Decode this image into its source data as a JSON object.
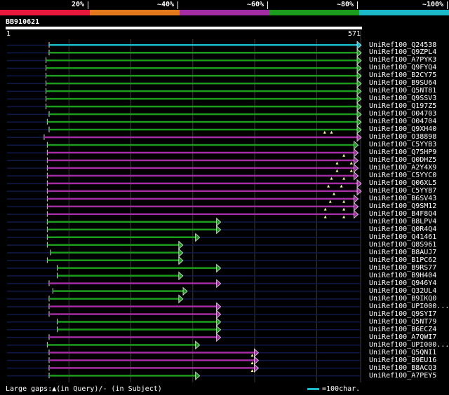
{
  "query": {
    "name": "BB910621",
    "start": "1",
    "end": "571",
    "length": 571
  },
  "legend": [
    {
      "label": "20%",
      "color": "#e8183c"
    },
    {
      "label": "~40%",
      "color": "#e4781c"
    },
    {
      "label": "~60%",
      "color": "#a42ca4"
    },
    {
      "label": "~80%",
      "color": "#1c9c1c"
    },
    {
      "label": "~100%",
      "color": "#1ab8c9"
    }
  ],
  "footer": {
    "gaps_text": "Large gaps:▲(in Query)/- (in Subject)",
    "scale_text": "=100char."
  },
  "hits": [
    {
      "name": "UniRef100_Q24538",
      "qstart": 68,
      "qend": 571,
      "identity": "~100%",
      "color": "#1ab8c9",
      "gaps": []
    },
    {
      "name": "UniRef100_Q9ZPL4",
      "qstart": 68,
      "qend": 571,
      "identity": "~80%",
      "color": "#1c9c1c",
      "gaps": []
    },
    {
      "name": "UniRef100_A7PYK3",
      "qstart": 63,
      "qend": 571,
      "identity": "~80%",
      "color": "#1c9c1c",
      "gaps": []
    },
    {
      "name": "UniRef100_Q9FYQ4",
      "qstart": 63,
      "qend": 571,
      "identity": "~80%",
      "color": "#1c9c1c",
      "gaps": []
    },
    {
      "name": "UniRef100_B2CY75",
      "qstart": 63,
      "qend": 571,
      "identity": "~80%",
      "color": "#1c9c1c",
      "gaps": []
    },
    {
      "name": "UniRef100_B9SU64",
      "qstart": 63,
      "qend": 571,
      "identity": "~80%",
      "color": "#1c9c1c",
      "gaps": []
    },
    {
      "name": "UniRef100_Q5NT81",
      "qstart": 63,
      "qend": 571,
      "identity": "~80%",
      "color": "#1c9c1c",
      "gaps": []
    },
    {
      "name": "UniRef100_Q9SSV3",
      "qstart": 63,
      "qend": 571,
      "identity": "~80%",
      "color": "#1c9c1c",
      "gaps": []
    },
    {
      "name": "UniRef100_Q197Z5",
      "qstart": 63,
      "qend": 571,
      "identity": "~80%",
      "color": "#1c9c1c",
      "gaps": []
    },
    {
      "name": "UniRef100_O04703",
      "qstart": 68,
      "qend": 571,
      "identity": "~80%",
      "color": "#1c9c1c",
      "gaps": []
    },
    {
      "name": "UniRef100_O04704",
      "qstart": 65,
      "qend": 571,
      "identity": "~80%",
      "color": "#1c9c1c",
      "gaps": []
    },
    {
      "name": "UniRef100_Q9XH40",
      "qstart": 68,
      "qend": 571,
      "identity": "~80%",
      "color": "#1c9c1c",
      "gaps": [
        513,
        524
      ]
    },
    {
      "name": "UniRef100_O38898",
      "qstart": 60,
      "qend": 571,
      "identity": "~60%",
      "color": "#a42ca4",
      "gaps": []
    },
    {
      "name": "UniRef100_C5YYB3",
      "qstart": 65,
      "qend": 566,
      "identity": "~80%",
      "color": "#1c9c1c",
      "gaps": []
    },
    {
      "name": "UniRef100_Q75HP9",
      "qstart": 65,
      "qend": 566,
      "identity": "~60%",
      "color": "#a42ca4",
      "gaps": [
        544
      ]
    },
    {
      "name": "UniRef100_Q0DHZ5",
      "qstart": 65,
      "qend": 566,
      "identity": "~60%",
      "color": "#a42ca4",
      "gaps": [
        533,
        556
      ]
    },
    {
      "name": "UniRef100_A2Y4X9",
      "qstart": 65,
      "qend": 566,
      "identity": "~60%",
      "color": "#a42ca4",
      "gaps": [
        533,
        556
      ]
    },
    {
      "name": "UniRef100_C5YYC0",
      "qstart": 65,
      "qend": 566,
      "identity": "~60%",
      "color": "#a42ca4",
      "gaps": [
        524,
        544
      ]
    },
    {
      "name": "UniRef100_Q06XL5",
      "qstart": 65,
      "qend": 571,
      "identity": "~60%",
      "color": "#a42ca4",
      "gaps": [
        519,
        540
      ]
    },
    {
      "name": "UniRef100_C5YYB7",
      "qstart": 65,
      "qend": 571,
      "identity": "~60%",
      "color": "#a42ca4",
      "gaps": [
        528
      ]
    },
    {
      "name": "UniRef100_B6SV43",
      "qstart": 65,
      "qend": 566,
      "identity": "~60%",
      "color": "#a42ca4",
      "gaps": [
        522,
        544
      ]
    },
    {
      "name": "UniRef100_Q9SM12",
      "qstart": 65,
      "qend": 566,
      "identity": "~60%",
      "color": "#a42ca4",
      "gaps": [
        514,
        544
      ]
    },
    {
      "name": "UniRef100_B4F8Q4",
      "qstart": 65,
      "qend": 566,
      "identity": "~60%",
      "color": "#a42ca4",
      "gaps": [
        514,
        544
      ]
    },
    {
      "name": "UniRef100_B8LPV4",
      "qstart": 65,
      "qend": 344,
      "identity": "~80%",
      "color": "#1c9c1c",
      "gaps": []
    },
    {
      "name": "UniRef100_Q0R4Q4",
      "qstart": 65,
      "qend": 344,
      "identity": "~80%",
      "color": "#1c9c1c",
      "gaps": []
    },
    {
      "name": "UniRef100_Q41461",
      "qstart": 65,
      "qend": 310,
      "identity": "~80%",
      "color": "#1c9c1c",
      "gaps": []
    },
    {
      "name": "UniRef100_Q8S961",
      "qstart": 65,
      "qend": 283,
      "identity": "~80%",
      "color": "#1c9c1c",
      "gaps": []
    },
    {
      "name": "UniRef100_B8AUJ7",
      "qstart": 70,
      "qend": 283,
      "identity": "~80%",
      "color": "#1c9c1c",
      "gaps": []
    },
    {
      "name": "UniRef100_B1PC62",
      "qstart": 65,
      "qend": 283,
      "identity": "~80%",
      "color": "#1c9c1c",
      "gaps": []
    },
    {
      "name": "UniRef100_B9RS77",
      "qstart": 81,
      "qend": 344,
      "identity": "~80%",
      "color": "#1c9c1c",
      "gaps": []
    },
    {
      "name": "UniRef100_B9H404",
      "qstart": 81,
      "qend": 283,
      "identity": "~80%",
      "color": "#1c9c1c",
      "gaps": []
    },
    {
      "name": "UniRef100_Q946Y4",
      "qstart": 68,
      "qend": 344,
      "identity": "~60%",
      "color": "#a42ca4",
      "gaps": []
    },
    {
      "name": "UniRef100_Q32UL4",
      "qstart": 74,
      "qend": 290,
      "identity": "~80%",
      "color": "#1c9c1c",
      "gaps": []
    },
    {
      "name": "UniRef100_B9IKQ0",
      "qstart": 68,
      "qend": 283,
      "identity": "~80%",
      "color": "#1c9c1c",
      "gaps": []
    },
    {
      "name": "UniRef100_UPI000...",
      "qstart": 68,
      "qend": 344,
      "identity": "~60%",
      "color": "#a42ca4",
      "gaps": []
    },
    {
      "name": "UniRef100_Q9SYI7",
      "qstart": 68,
      "qend": 344,
      "identity": "~60%",
      "color": "#a42ca4",
      "gaps": []
    },
    {
      "name": "UniRef100_Q5NT79",
      "qstart": 81,
      "qend": 344,
      "identity": "~80%",
      "color": "#1c9c1c",
      "gaps": []
    },
    {
      "name": "UniRef100_B6ECZ4",
      "qstart": 81,
      "qend": 344,
      "identity": "~80%",
      "color": "#1c9c1c",
      "gaps": []
    },
    {
      "name": "UniRef100_A7QWI7",
      "qstart": 68,
      "qend": 344,
      "identity": "~60%",
      "color": "#a42ca4",
      "gaps": []
    },
    {
      "name": "UniRef100_UPI000...",
      "qstart": 65,
      "qend": 310,
      "identity": "~80%",
      "color": "#1c9c1c",
      "gaps": []
    },
    {
      "name": "UniRef100_Q5QNI1",
      "qstart": 68,
      "qend": 405,
      "identity": "~60%",
      "color": "#a42ca4",
      "gaps": [
        396
      ]
    },
    {
      "name": "UniRef100_B9EU16",
      "qstart": 68,
      "qend": 405,
      "identity": "~60%",
      "color": "#a42ca4",
      "gaps": [
        396
      ]
    },
    {
      "name": "UniRef100_B8ACQ3",
      "qstart": 68,
      "qend": 405,
      "identity": "~60%",
      "color": "#a42ca4",
      "gaps": [
        396
      ]
    },
    {
      "name": "UniRef100_A7PEY5",
      "qstart": 68,
      "qend": 310,
      "identity": "~80%",
      "color": "#1c9c1c",
      "gaps": []
    }
  ]
}
